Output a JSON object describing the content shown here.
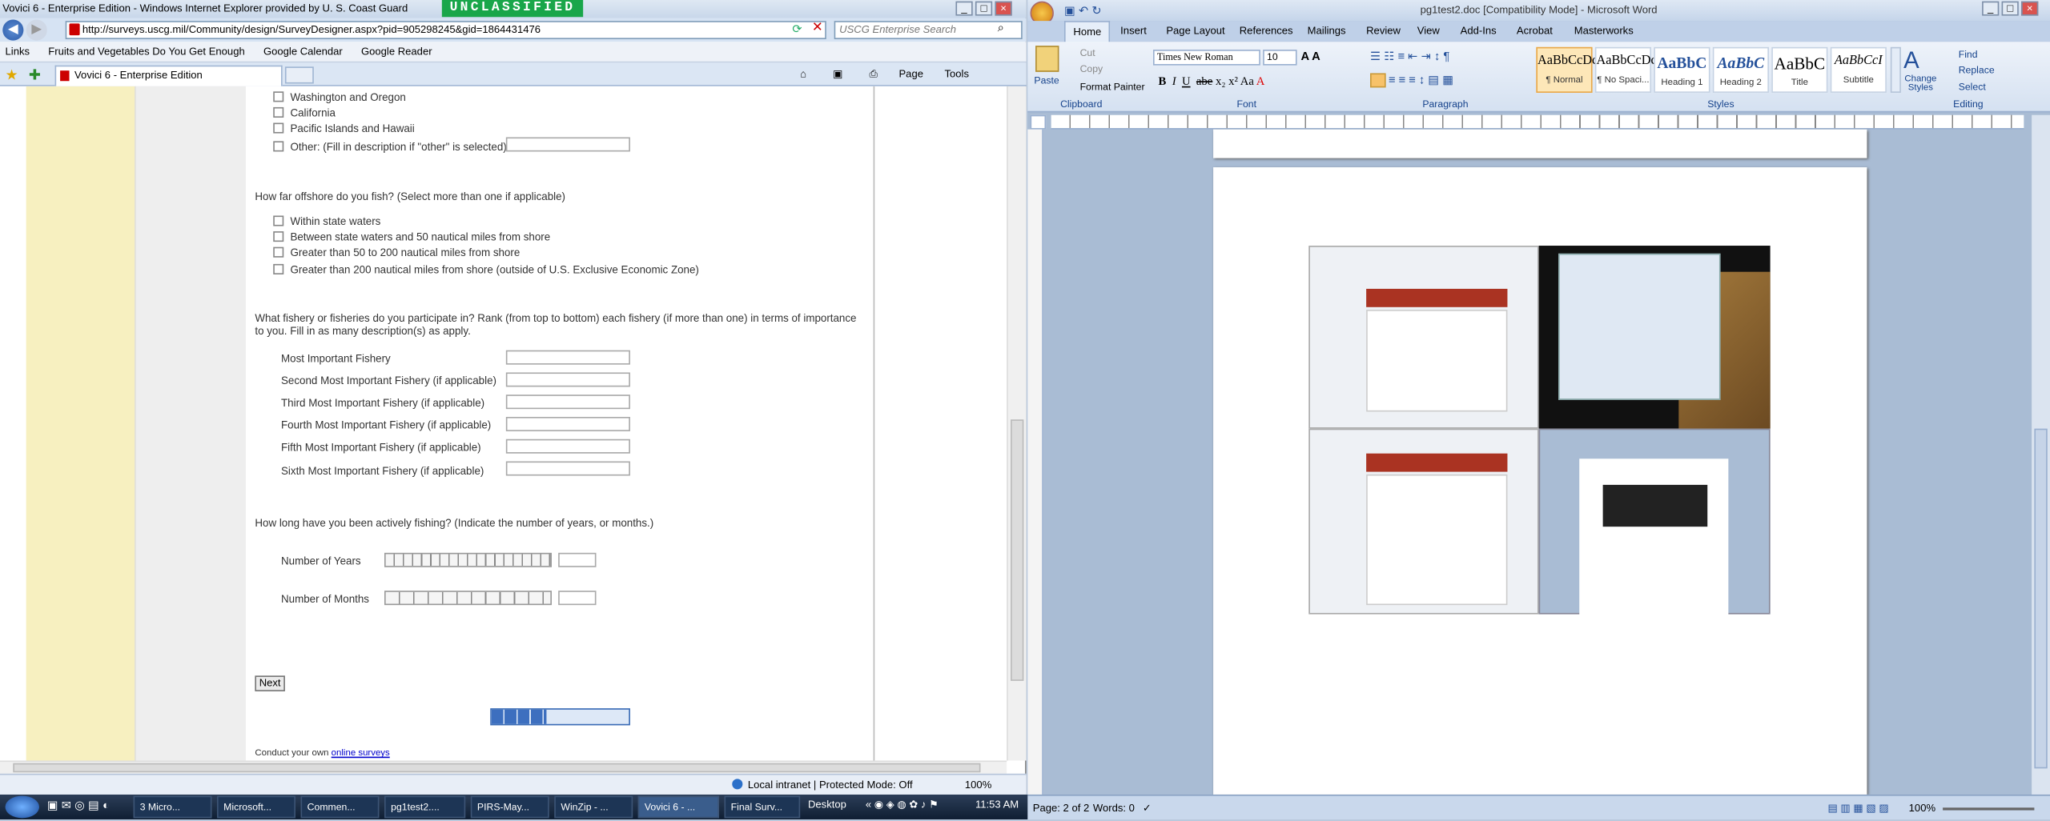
{
  "ie": {
    "title": "Vovici 6 - Enterprise Edition - Windows Internet Explorer provided by U. S. Coast Guard",
    "banner": "UNCLASSIFIED",
    "address": "http://surveys.uscg.mil/Community/design/SurveyDesigner.aspx?pid=905298245&gid=1864431476",
    "search_placeholder": "USCG Enterprise Search",
    "links_label": "Links",
    "favorites": [
      "Fruits and Vegetables Do You Get Enough",
      "Google Calendar",
      "Google Reader"
    ],
    "tab": "Vovici 6 - Enterprise Edition",
    "cmd": {
      "page": "Page",
      "tools": "Tools"
    },
    "status_zone": "Local intranet | Protected Mode: Off",
    "zoom": "100%"
  },
  "survey": {
    "regions": [
      "Washington and Oregon",
      "California",
      "Pacific Islands and Hawaii",
      "Other: (Fill in description if \"other\" is selected)"
    ],
    "q_offshore": "How far offshore do you fish? (Select more than one if applicable)",
    "offshore_options": [
      "Within state waters",
      "Between state waters and 50 nautical miles from shore",
      "Greater than 50 to 200 nautical miles from shore",
      "Greater than 200 nautical miles from shore (outside of U.S. Exclusive Economic Zone)"
    ],
    "q_fishery": "What fishery or fisheries do you participate in? Rank (from top to bottom) each fishery (if more than one) in terms of importance to you. Fill in as many description(s) as apply.",
    "fisheries": [
      "Most Important Fishery",
      "Second Most Important  Fishery (if applicable)",
      "Third Most Important  Fishery (if applicable)",
      "Fourth Most Important Fishery (if applicable)",
      "Fifth Most Important  Fishery (if applicable)",
      "Sixth Most Important Fishery (if applicable)"
    ],
    "q_years": "How long have you been actively fishing? (Indicate the number of years, or months.)",
    "years_label": "Number of Years",
    "months_label": "Number of Months",
    "next_label": "Next",
    "progress_fraction": 0.4,
    "footer_prefix": "Conduct your own ",
    "footer_link": "online surveys"
  },
  "word": {
    "title": "pg1test2.doc [Compatibility Mode] - Microsoft Word",
    "tabs": [
      "Home",
      "Insert",
      "Page Layout",
      "References",
      "Mailings",
      "Review",
      "View",
      "Add-Ins",
      "Acrobat",
      "Masterworks"
    ],
    "clipboard": {
      "paste": "Paste",
      "cut": "Cut",
      "copy": "Copy",
      "painter": "Format Painter",
      "label": "Clipboard"
    },
    "font": {
      "name": "Times New Roman",
      "size": "10",
      "label": "Font"
    },
    "paragraph_label": "Paragraph",
    "styles": [
      {
        "sample": "AaBbCcDc",
        "name": "¶ Normal"
      },
      {
        "sample": "AaBbCcDc",
        "name": "¶ No Spaci..."
      },
      {
        "sample": "AaBbC",
        "name": "Heading 1"
      },
      {
        "sample": "AaBbC",
        "name": "Heading 2"
      },
      {
        "sample": "AaBbC",
        "name": "Title"
      },
      {
        "sample": "AaBbCcI",
        "name": "Subtitle"
      }
    ],
    "styles_label": "Styles",
    "change_styles": "Change Styles",
    "editing": {
      "find": "Find",
      "replace": "Replace",
      "select": "Select",
      "label": "Editing"
    },
    "status_page": "Page: 2 of 2",
    "status_words": "Words: 0",
    "status_zoom": "100%"
  },
  "taskbar": {
    "items": [
      "3 Micro...",
      "Microsoft...",
      "Commen...",
      "pg1test2....",
      "PIRS-May...",
      "WinZip - ...",
      "Vovici 6 - ...",
      "Final Surv..."
    ],
    "desktop": "Desktop",
    "clock": "11:53 AM"
  }
}
